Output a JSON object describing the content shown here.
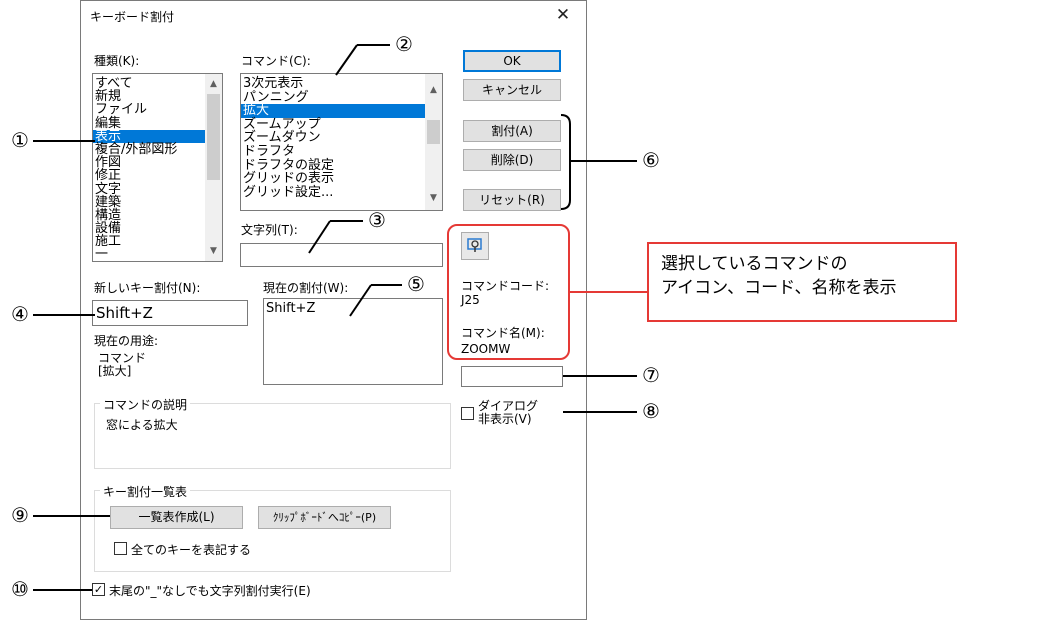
{
  "dialog": {
    "title": "キーボード割付",
    "close_glyph": "✕",
    "category_label": "種類(K):",
    "category_items": [
      "すべて",
      "新規",
      "ファイル",
      "編集",
      "表示",
      "複合/外部図形",
      "作図",
      "修正",
      "文字",
      "建築",
      "構造",
      "設備",
      "施工",
      "一"
    ],
    "category_selected": 4,
    "command_label": "コマンド(C):",
    "command_items": [
      "3次元表示",
      "パンニング",
      "拡大",
      "ズームアップ",
      "ズームダウン",
      "ドラフタ",
      "ドラフタの設定",
      "グリッドの表示",
      "グリッド設定..."
    ],
    "command_selected": 2,
    "ok_label": "OK",
    "cancel_label": "キャンセル",
    "assign_label": "割付(A)",
    "delete_label": "削除(D)",
    "reset_label": "リセット(R)",
    "string_label": "文字列(T):",
    "string_value": "",
    "new_key_label": "新しいキー割付(N):",
    "new_key_value": "Shift+Z",
    "current_assign_label": "現在の割付(W):",
    "current_assign_value": "Shift+Z",
    "current_use_label": "現在の用途:",
    "current_use_value_1": "コマンド",
    "current_use_value_2": "[拡大]",
    "command_code_label": "コマンドコード:",
    "command_code_value": "J25",
    "command_name_label": "コマンド名(M):",
    "command_name_value": "ZOOMW",
    "extra_input_value": "",
    "dialog_hide_label_1": "ダイアログ",
    "dialog_hide_label_2": "非表示(V)",
    "dialog_hide_checked": false,
    "description_group": "コマンドの説明",
    "description_text": "窓による拡大",
    "keylist_group": "キー割付一覧表",
    "make_list_label": "一覧表作成(L)",
    "copy_clipboard_label": "ｸﾘｯﾌﾟﾎﾞｰﾄﾞへｺﾋﾟｰ(P)",
    "all_keys_label": "全てのキーを表記する",
    "all_keys_checked": false,
    "trailing_label": "末尾の\"_\"なしでも文字列割付実行(E)",
    "trailing_checked": true
  },
  "annotations": {
    "n1": "①",
    "n2": "②",
    "n3": "③",
    "n4": "④",
    "n5": "⑤",
    "n6": "⑥",
    "n7": "⑦",
    "n8": "⑧",
    "n9": "⑨",
    "n10": "⑩",
    "notice_line1": "選択しているコマンドの",
    "notice_line2": "アイコン、コード、名称を表示"
  },
  "colors": {
    "selection": "#0078d7",
    "callout_red": "#e53935",
    "default_border": "#0078d7"
  },
  "icons": {
    "command_icon": "zoom-window-icon"
  }
}
